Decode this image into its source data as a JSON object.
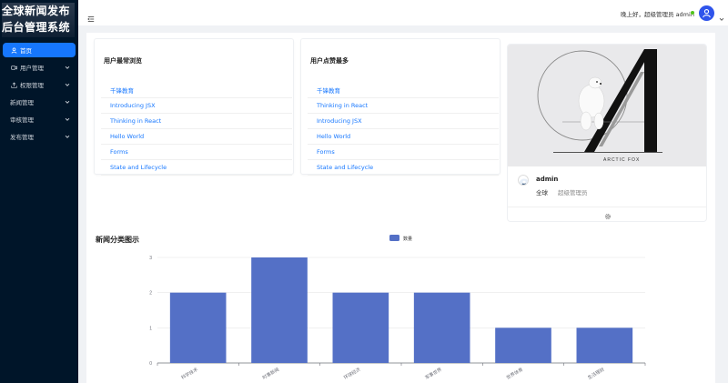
{
  "sidebar": {
    "logo_line1": "全球新闻发布",
    "logo_line2": "后台管理系统",
    "items": [
      {
        "label": "首页",
        "icon": "user-icon",
        "active": true
      },
      {
        "label": "用户管理",
        "icon": "video-icon",
        "expandable": true
      },
      {
        "label": "权限管理",
        "icon": "upload-icon",
        "expandable": true
      },
      {
        "label": "新闻管理",
        "expandable": true
      },
      {
        "label": "审核管理",
        "expandable": true
      },
      {
        "label": "发布管理",
        "expandable": true
      }
    ]
  },
  "header": {
    "greeting": "晚上好，超级管理员 admin",
    "status_color": "#52c41a"
  },
  "most_viewed": {
    "title": "用户最常浏览",
    "items": [
      "千锋教育",
      "Introducing JSX",
      "Thinking in React",
      "Hello World",
      "Forms",
      "State and Lifecycle"
    ]
  },
  "most_liked": {
    "title": "用户点赞最多",
    "items": [
      "千锋教育",
      "Thinking in React",
      "Introducing JSX",
      "Hello World",
      "Forms",
      "State and Lifecycle"
    ]
  },
  "profile": {
    "cover_caption": "ARCTIC FOX",
    "name": "admin",
    "region": "全球",
    "role": "超级管理员"
  },
  "chart_section": {
    "title": "新闻分类图示"
  },
  "chart_data": {
    "type": "bar",
    "categories": [
      "科学技术",
      "时事新闻",
      "环球经济",
      "军事世界",
      "世界体育",
      "生活理财"
    ],
    "series": [
      {
        "name": "数量",
        "values": [
          2,
          3,
          2,
          2,
          1,
          1
        ],
        "color": "#5470c6"
      }
    ],
    "ylim": [
      0,
      3
    ],
    "yticks": [
      0,
      1,
      2,
      3
    ],
    "legend": "top-center",
    "grid": true
  },
  "colors": {
    "accent": "#1677ff",
    "sidebar_bg": "#001529",
    "bar": "#5470c6"
  }
}
